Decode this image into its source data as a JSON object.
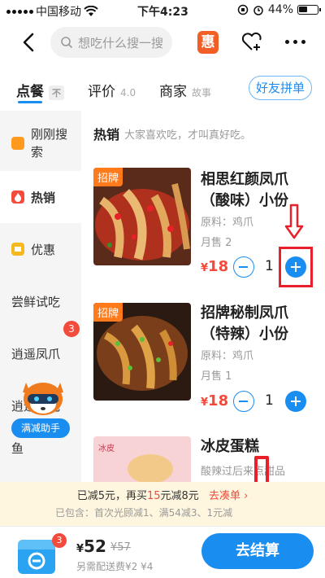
{
  "status": {
    "carrier": "中国移动",
    "time": "下午4:23",
    "battery": "44%"
  },
  "nav": {
    "search_placeholder": "想吃什么搜一搜",
    "coupon_label": "惠"
  },
  "tabs": [
    {
      "label": "点餐",
      "tag": "不"
    },
    {
      "label": "评价",
      "score": "4.0"
    },
    {
      "label": "商家",
      "tag": "故事"
    }
  ],
  "group_button": "好友拼单",
  "sidebar": {
    "items": [
      {
        "label": "刚刚搜索",
        "icon": "search-history-icon"
      },
      {
        "label": "热销",
        "icon": "flame-icon"
      },
      {
        "label": "优惠",
        "icon": "discount-icon"
      },
      {
        "label": "尝鲜试吃"
      },
      {
        "label": "逍遥凤爪",
        "badge": "3"
      },
      {
        "label": "逍遥凤吃"
      },
      {
        "label": "鱼"
      }
    ],
    "helper_button": "满减助手"
  },
  "section": {
    "title": "热销",
    "subtitle": "大家喜欢吃，才叫真好吃。"
  },
  "items": [
    {
      "badge": "招牌",
      "name": "相思红颜凤爪（酸味）小份",
      "material": "原料：鸡爪",
      "sales": "月售 2",
      "price_symbol": "¥",
      "price": "18",
      "qty": "1"
    },
    {
      "badge": "招牌",
      "name": "招牌秘制凤爪（特辣）小份",
      "material": "原料：鸡爪",
      "sales": "月售 1",
      "price_symbol": "¥",
      "price": "18",
      "qty": "1"
    },
    {
      "name": "冰皮蛋糕",
      "desc": "酸辣过后来点甜品",
      "image_text": "冰皮"
    }
  ],
  "discount": {
    "prefix": "已减5元，再买",
    "amount": "15",
    "middle": "元减8元",
    "link": "去凑单",
    "details": "已包含：首次光顾减1、满54减3、1元减"
  },
  "bottom": {
    "cart_count": "3",
    "price_symbol": "¥",
    "total": "52",
    "original": "¥57",
    "delivery": "另需配送费¥2 ¥4",
    "checkout": "去结算"
  },
  "colors": {
    "accent": "#1a8df0",
    "price_red": "#f24a3b",
    "badge_orange": "#ff7a1a",
    "annotation_red": "#e8202a"
  }
}
